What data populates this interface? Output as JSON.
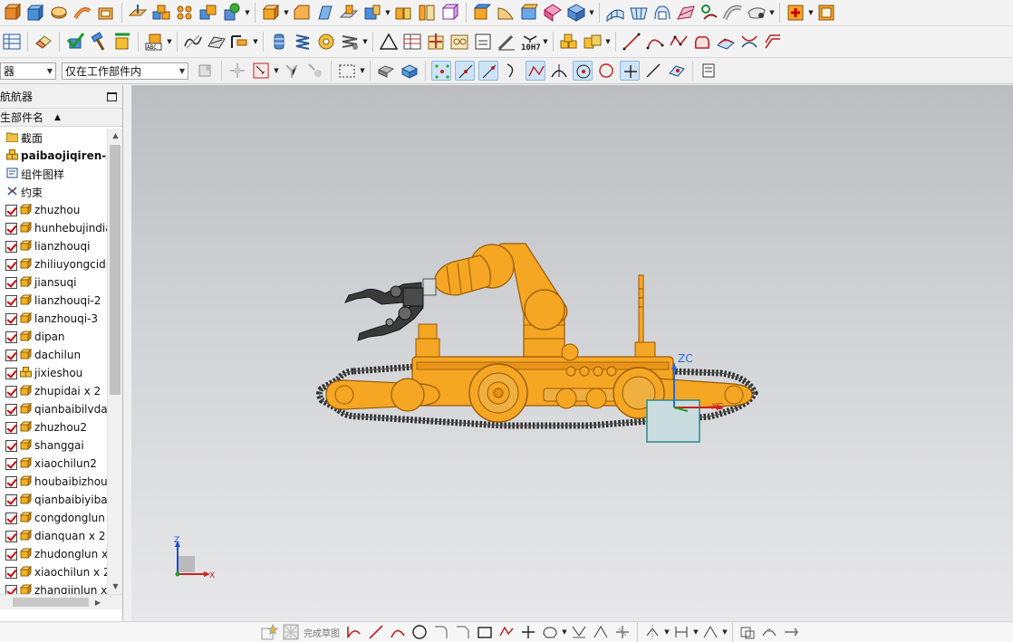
{
  "toolbar": {
    "assembly_filter": "器",
    "scope_filter": "仅在工作部件内",
    "dim_label": "10H7"
  },
  "navigator": {
    "title": "航航器",
    "column_header": "生部件名",
    "items": [
      {
        "label": "截面",
        "icon": "folder-icon",
        "checkbox": false,
        "bold": false
      },
      {
        "label": "paibaojiqiren-zh",
        "icon": "assembly-icon",
        "checkbox": false,
        "bold": true
      },
      {
        "label": "组件图样",
        "icon": "drawing-icon",
        "checkbox": false,
        "bold": false
      },
      {
        "label": "约束",
        "icon": "constraint-icon",
        "checkbox": false,
        "bold": false
      },
      {
        "label": "zhuzhou",
        "icon": "part-icon",
        "checkbox": true,
        "bold": false
      },
      {
        "label": "hunhebujindia",
        "icon": "part-icon",
        "checkbox": true,
        "bold": false
      },
      {
        "label": "lianzhouqi",
        "icon": "part-icon",
        "checkbox": true,
        "bold": false
      },
      {
        "label": "zhiliuyongcidi",
        "icon": "part-icon",
        "checkbox": true,
        "bold": false
      },
      {
        "label": "jiansuqi",
        "icon": "part-icon",
        "checkbox": true,
        "bold": false
      },
      {
        "label": "lianzhouqi-2",
        "icon": "part-icon",
        "checkbox": true,
        "bold": false
      },
      {
        "label": "lanzhouqi-3",
        "icon": "part-icon",
        "checkbox": true,
        "bold": false
      },
      {
        "label": "dipan",
        "icon": "part-icon",
        "checkbox": true,
        "bold": false
      },
      {
        "label": "dachilun",
        "icon": "part-icon",
        "checkbox": true,
        "bold": false
      },
      {
        "label": "jixieshou",
        "icon": "assembly-icon",
        "checkbox": true,
        "bold": false
      },
      {
        "label": "zhupidai x 2",
        "icon": "part-icon",
        "checkbox": true,
        "bold": false
      },
      {
        "label": "qianbaibilvda",
        "icon": "part-icon",
        "checkbox": true,
        "bold": false
      },
      {
        "label": "zhuzhou2",
        "icon": "part-icon",
        "checkbox": true,
        "bold": false
      },
      {
        "label": "shanggai",
        "icon": "part-icon",
        "checkbox": true,
        "bold": false
      },
      {
        "label": "xiaochilun2",
        "icon": "part-icon",
        "checkbox": true,
        "bold": false
      },
      {
        "label": "houbaibizhou",
        "icon": "part-icon",
        "checkbox": true,
        "bold": false
      },
      {
        "label": "qianbaibiyiba",
        "icon": "part-icon",
        "checkbox": true,
        "bold": false
      },
      {
        "label": "congdonglun",
        "icon": "part-icon",
        "checkbox": true,
        "bold": false
      },
      {
        "label": "dianquan x 2",
        "icon": "part-icon",
        "checkbox": true,
        "bold": false
      },
      {
        "label": "zhudonglun x",
        "icon": "part-icon",
        "checkbox": true,
        "bold": false
      },
      {
        "label": "xiaochilun x 2",
        "icon": "part-icon",
        "checkbox": true,
        "bold": false
      },
      {
        "label": "zhangjinlun x",
        "icon": "part-icon",
        "checkbox": true,
        "bold": false
      }
    ]
  },
  "viewport": {
    "wcs_z_label": "ZC",
    "wcs_x_label": "XC",
    "triad_z_label": "Z",
    "triad_x_label": "X"
  },
  "statusbar": {
    "finish_sketch_label": "完成草图"
  },
  "colors": {
    "model_orange": "#f5a623",
    "model_dark": "#3a3a3a",
    "viewport_top": "#bcbdc1",
    "viewport_bottom": "#e8e8ea",
    "checkbox_mark": "#d00000"
  }
}
